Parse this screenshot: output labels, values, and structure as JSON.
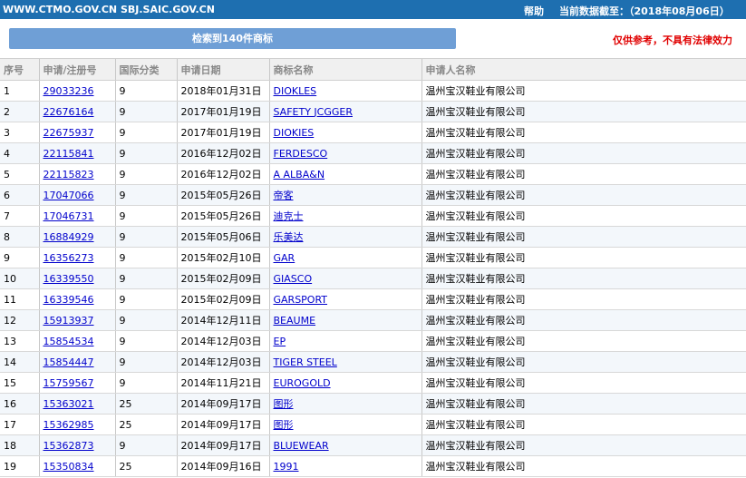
{
  "header": {
    "site": "WWW.CTMO.GOV.CN SBJ.SAIC.GOV.CN",
    "help": "帮助",
    "date_label": "当前数据截至：（2018年08月06日）"
  },
  "toolbar": {
    "search_result": "检索到140件商标",
    "disclaimer": "仅供参考，不具有法律效力"
  },
  "table": {
    "headers": [
      "序号",
      "申请/注册号",
      "国际分类",
      "申请日期",
      "商标名称",
      "申请人名称"
    ],
    "rows": [
      [
        "1",
        "29033236",
        "9",
        "2018年01月31日",
        "DIOKLES",
        "温州宝汉鞋业有限公司"
      ],
      [
        "2",
        "22676164",
        "9",
        "2017年01月19日",
        "SAFETY JCGGER",
        "温州宝汉鞋业有限公司"
      ],
      [
        "3",
        "22675937",
        "9",
        "2017年01月19日",
        "DIOKIES",
        "温州宝汉鞋业有限公司"
      ],
      [
        "4",
        "22115841",
        "9",
        "2016年12月02日",
        "FERDESCO",
        "温州宝汉鞋业有限公司"
      ],
      [
        "5",
        "22115823",
        "9",
        "2016年12月02日",
        "A ALBA&N",
        "温州宝汉鞋业有限公司"
      ],
      [
        "6",
        "17047066",
        "9",
        "2015年05月26日",
        "帝客",
        "温州宝汉鞋业有限公司"
      ],
      [
        "7",
        "17046731",
        "9",
        "2015年05月26日",
        "迪克士",
        "温州宝汉鞋业有限公司"
      ],
      [
        "8",
        "16884929",
        "9",
        "2015年05月06日",
        "乐美达",
        "温州宝汉鞋业有限公司"
      ],
      [
        "9",
        "16356273",
        "9",
        "2015年02月10日",
        "GAR",
        "温州宝汉鞋业有限公司"
      ],
      [
        "10",
        "16339550",
        "9",
        "2015年02月09日",
        "GIASCO",
        "温州宝汉鞋业有限公司"
      ],
      [
        "11",
        "16339546",
        "9",
        "2015年02月09日",
        "GARSPORT",
        "温州宝汉鞋业有限公司"
      ],
      [
        "12",
        "15913937",
        "9",
        "2014年12月11日",
        "BEAUME",
        "温州宝汉鞋业有限公司"
      ],
      [
        "13",
        "15854534",
        "9",
        "2014年12月03日",
        "EP",
        "温州宝汉鞋业有限公司"
      ],
      [
        "14",
        "15854447",
        "9",
        "2014年12月03日",
        "TIGER STEEL",
        "温州宝汉鞋业有限公司"
      ],
      [
        "15",
        "15759567",
        "9",
        "2014年11月21日",
        "EUROGOLD",
        "温州宝汉鞋业有限公司"
      ],
      [
        "16",
        "15363021",
        "25",
        "2014年09月17日",
        "图形",
        "温州宝汉鞋业有限公司"
      ],
      [
        "17",
        "15362985",
        "25",
        "2014年09月17日",
        "图形",
        "温州宝汉鞋业有限公司"
      ],
      [
        "18",
        "15362873",
        "9",
        "2014年09月17日",
        "BLUEWEAR",
        "温州宝汉鞋业有限公司"
      ],
      [
        "19",
        "15350834",
        "25",
        "2014年09月16日",
        "1991",
        "温州宝汉鞋业有限公司"
      ]
    ]
  },
  "colors": {
    "header_bar": "#1e6fb0",
    "search_button": "#6f9fd6",
    "disclaimer": "#e00000",
    "link": "#0000cc"
  }
}
